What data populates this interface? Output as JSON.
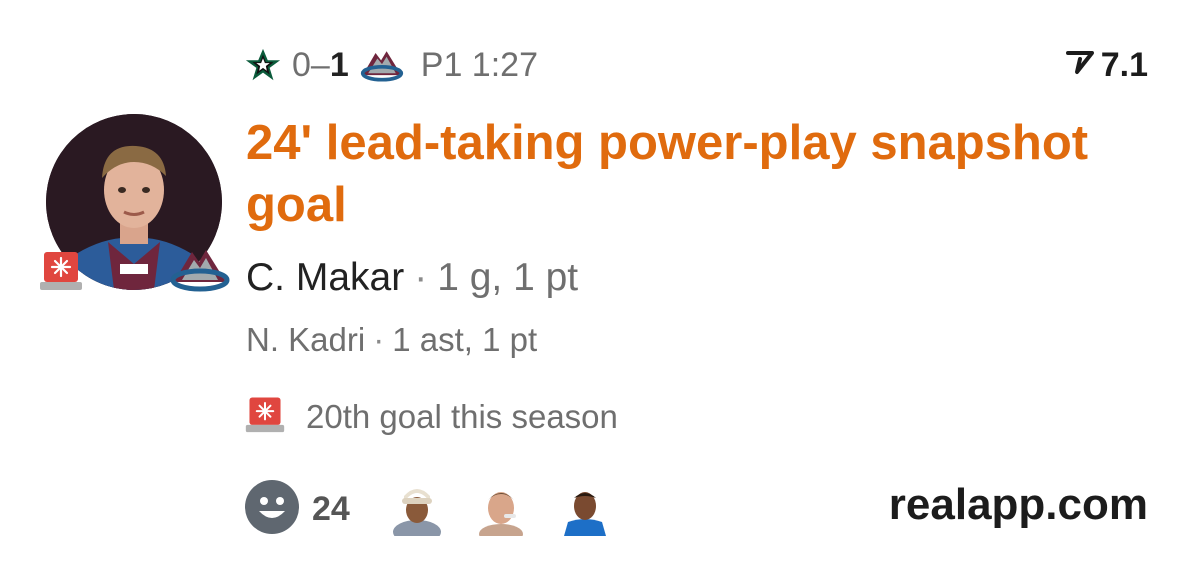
{
  "score": {
    "away": "0",
    "sep": "–",
    "home": "1",
    "period": "P1 1:27"
  },
  "teams": {
    "away_icon": "stars-logo-icon",
    "home_icon": "avalanche-logo-icon"
  },
  "rating": {
    "icon": "rating-chevron-icon",
    "value": "7.1"
  },
  "headline": "24' lead-taking power-play snapshot goal",
  "scorer": {
    "name": "C. Makar",
    "sep": "·",
    "stats": "1 g, 1 pt"
  },
  "assist": {
    "name": "N. Kadri",
    "sep": "·",
    "stats": "1 ast, 1 pt"
  },
  "milestone": {
    "icon": "siren-icon",
    "text": "20th goal this season"
  },
  "reactions": {
    "icon": "smiley-icon",
    "count": "24"
  },
  "brand": "realapp.com",
  "colors": {
    "headline": "#e06b0e",
    "muted": "#6f6f6f",
    "text": "#1c1c1c",
    "siren": "#e0463f"
  }
}
